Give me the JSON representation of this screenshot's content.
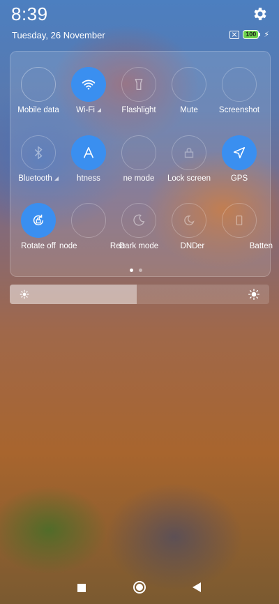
{
  "status": {
    "time": "8:39",
    "date": "Tuesday, 26 November",
    "battery": "100"
  },
  "tiles": [
    {
      "label": "Mobile data",
      "icon": "mobile-data-icon",
      "active": false
    },
    {
      "label": "Wi-Fi",
      "icon": "wifi-icon",
      "active": true
    },
    {
      "label": "Flashlight",
      "icon": "flashlight-icon",
      "active": false
    },
    {
      "label": "Mute",
      "icon": "mute-icon",
      "active": false
    },
    {
      "label": "Screenshot",
      "icon": "screenshot-icon",
      "active": false
    },
    {
      "label": "Bluetooth",
      "icon": "bluetooth-icon",
      "active": false
    },
    {
      "label": "htness",
      "icon": "auto-brightness-icon",
      "active": true
    },
    {
      "label": "ne mode",
      "icon": "airplane-mode-icon",
      "active": false
    },
    {
      "label": "Lock screen",
      "icon": "lock-screen-icon",
      "active": false
    },
    {
      "label": "GPS",
      "icon": "gps-icon",
      "active": true
    },
    {
      "label": "Rotate off",
      "icon": "rotate-lock-icon",
      "active": true
    },
    {
      "label": "node",
      "icon": "reading-mode-icon",
      "active": false
    },
    {
      "label": "Rea",
      "icon": "reading-icon",
      "active": false
    },
    {
      "label": "Dark mode",
      "icon": "dark-mode-icon",
      "active": false
    },
    {
      "label": "DND",
      "icon": "dnd-icon",
      "active": false
    },
    {
      "label": "er",
      "icon": "saver-icon",
      "active": false
    },
    {
      "label": "Batten",
      "icon": "battery-saver-icon",
      "active": false
    }
  ],
  "page_indicator": {
    "pages": 2,
    "current": 1
  },
  "brightness": {
    "level": 0.49
  },
  "colors": {
    "accent": "#3a8ff0",
    "battery": "#6cd14a"
  }
}
